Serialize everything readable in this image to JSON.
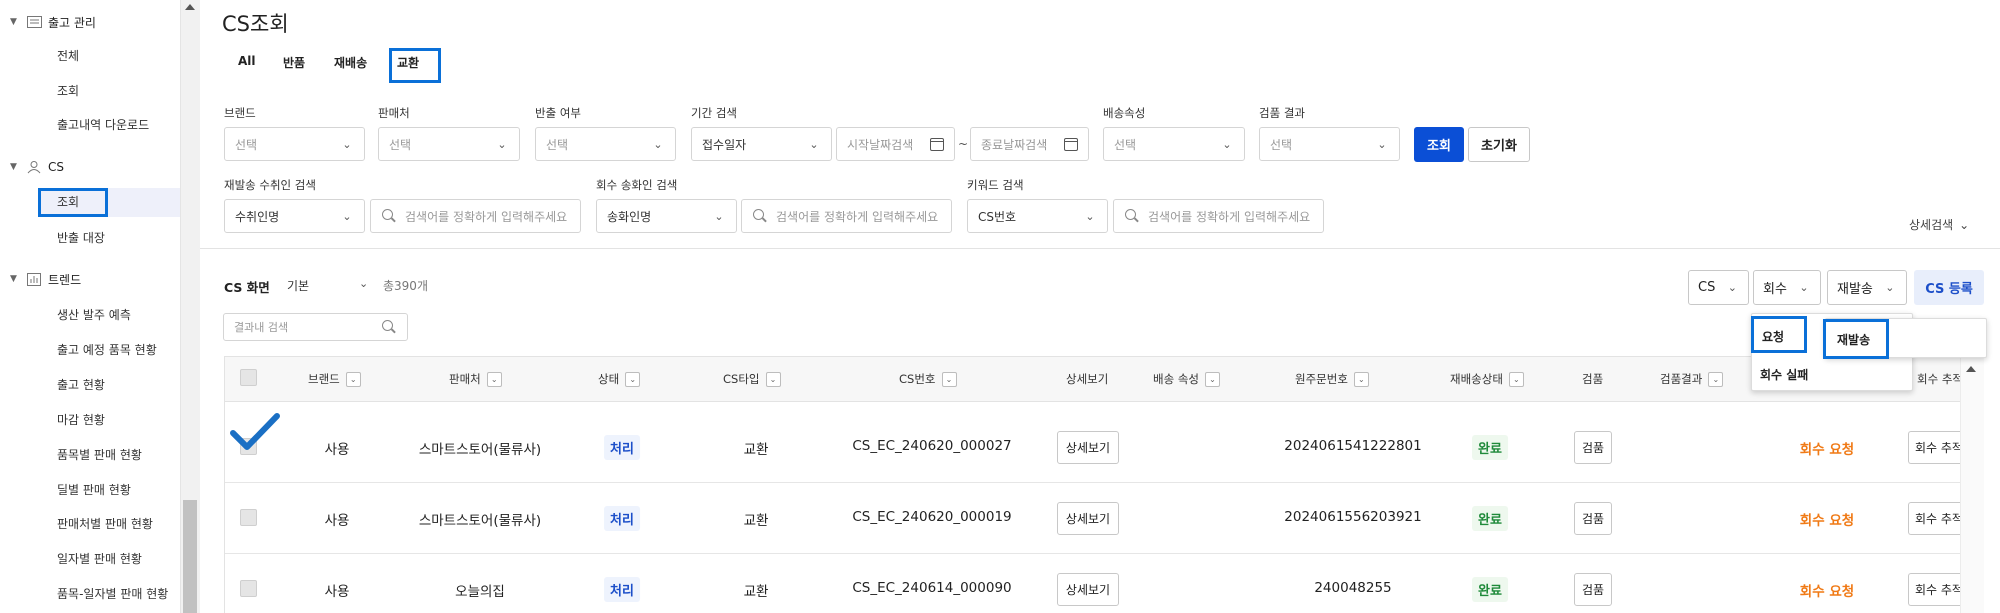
{
  "sidebar": {
    "groups": [
      {
        "label": "출고 관리",
        "items": [
          "전체",
          "조회",
          "출고내역 다운로드"
        ]
      },
      {
        "label": "CS",
        "items": [
          "조회",
          "반출 대장"
        ]
      },
      {
        "label": "트렌드",
        "items": [
          "생산 발주 예측",
          "출고 예정 품목 현황",
          "출고 현황",
          "마감 현황",
          "품목별 판매 현황",
          "딜별 판매 현황",
          "판매처별 판매 현황",
          "일자별 판매 현황",
          "품목-일자별 판매 현황"
        ]
      }
    ]
  },
  "page": {
    "title": "CS조회"
  },
  "tabs": [
    "All",
    "반품",
    "재배송",
    "교환"
  ],
  "filters": {
    "brand": {
      "label": "브랜드",
      "placeholder": "선택"
    },
    "seller": {
      "label": "판매처",
      "placeholder": "선택"
    },
    "shipout": {
      "label": "반출 여부",
      "placeholder": "선택"
    },
    "period": {
      "label": "기간 검색",
      "type_value": "접수일자",
      "start_placeholder": "시작날짜검색",
      "end_placeholder": "종료날짜검색",
      "separator": "~"
    },
    "delivery_attr": {
      "label": "배송속성",
      "placeholder": "선택"
    },
    "inspection_result": {
      "label": "검품 결과",
      "placeholder": "선택"
    },
    "resend_receiver": {
      "label": "재발송 수취인 검색",
      "type_value": "수취인명",
      "placeholder": "검색어를 정확하게 입력해주세요"
    },
    "return_sender": {
      "label": "회수 송화인 검색",
      "type_value": "송화인명",
      "placeholder": "검색어를 정확하게 입력해주세요"
    },
    "keyword": {
      "label": "키워드 검색",
      "type_value": "CS번호",
      "placeholder": "검색어를 정확하게 입력해주세요"
    },
    "search_button": "조회",
    "reset_button": "초기화",
    "detail_search": "상세검색"
  },
  "list": {
    "title": "CS 화면",
    "view": "기본",
    "total": "총390개",
    "result_search_placeholder": "결과내 검색",
    "toolbar": {
      "cs": "CS",
      "return": "회수",
      "resend": "재발송",
      "register": "CS 등록"
    },
    "return_menu": [
      "요청",
      "회수 실패"
    ],
    "resend_menu": [
      "재발송"
    ]
  },
  "table": {
    "columns": [
      "브랜드",
      "판매처",
      "상태",
      "CS타입",
      "CS번호",
      "상세보기",
      "배송 속성",
      "원주문번호",
      "재배송상태",
      "검품",
      "검품결과",
      "회수 추적"
    ],
    "rows": [
      {
        "brand": "사용",
        "seller": "스마트스토어(물류사)",
        "status": "처리",
        "cs_type": "교환",
        "cs_no": "CS_EC_240620_000027",
        "detail": "상세보기",
        "order_no": "2024061541222801",
        "resend_status": "완료",
        "inspect": "검품",
        "return_status": "회수 요청",
        "track": "회수 추적"
      },
      {
        "brand": "사용",
        "seller": "스마트스토어(물류사)",
        "status": "처리",
        "cs_type": "교환",
        "cs_no": "CS_EC_240620_000019",
        "detail": "상세보기",
        "order_no": "2024061556203921",
        "resend_status": "완료",
        "inspect": "검품",
        "return_status": "회수 요청",
        "track": "회수 추적"
      },
      {
        "brand": "사용",
        "seller": "오늘의집",
        "status": "처리",
        "cs_type": "교환",
        "cs_no": "CS_EC_240614_000090",
        "detail": "상세보기",
        "order_no": "240048255",
        "resend_status": "완료",
        "inspect": "검품",
        "return_status": "회수 요청",
        "track": "회수 추적"
      }
    ]
  },
  "icons": [
    "caret-down-icon",
    "list-icon",
    "user-icon",
    "chart-icon",
    "chevron-down-icon",
    "calendar-icon",
    "search-icon",
    "check-icon"
  ],
  "colors": {
    "primary": "#0b4fd6",
    "highlight": "#0a70d8",
    "status_blue": "#1c4fc9",
    "status_green": "#1f8a3a",
    "status_orange": "#f07a16"
  }
}
